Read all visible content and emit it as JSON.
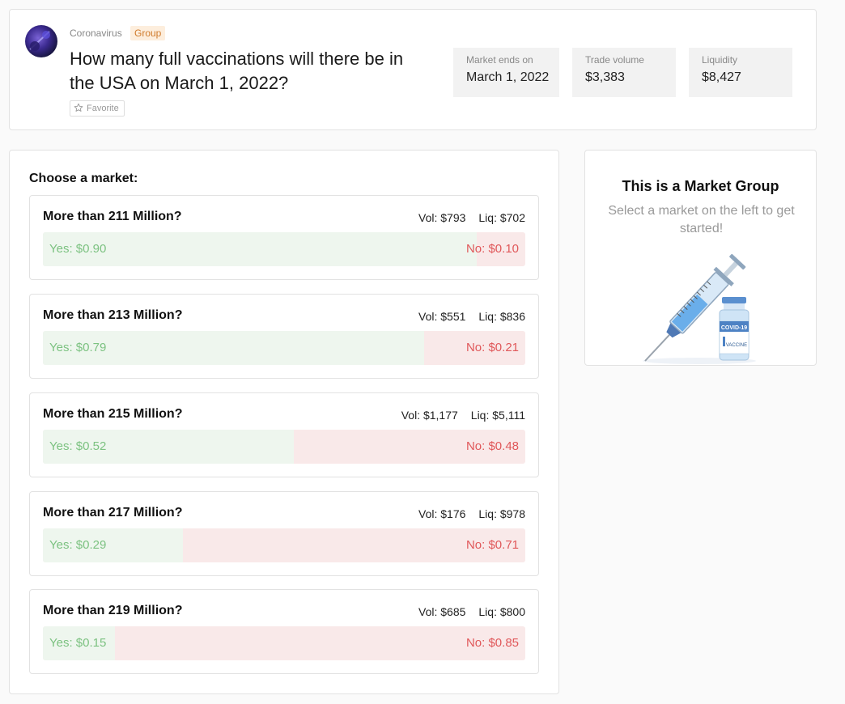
{
  "header": {
    "category": "Coronavirus",
    "badge": "Group",
    "title": "How many full vaccinations will there be in the USA on March 1, 2022?",
    "favorite_label": "Favorite",
    "stats": [
      {
        "label": "Market ends on",
        "value": "March 1, 2022"
      },
      {
        "label": "Trade volume",
        "value": "$3,383"
      },
      {
        "label": "Liquidity",
        "value": "$8,427"
      }
    ]
  },
  "markets": {
    "heading": "Choose a market:",
    "items": [
      {
        "title": "More than 211 Million?",
        "vol": "Vol: $793",
        "liq": "Liq: $702",
        "yes": "Yes: $0.90",
        "no": "No: $0.10",
        "yes_price": 0.9
      },
      {
        "title": "More than 213 Million?",
        "vol": "Vol: $551",
        "liq": "Liq: $836",
        "yes": "Yes: $0.79",
        "no": "No: $0.21",
        "yes_price": 0.79
      },
      {
        "title": "More than 215 Million?",
        "vol": "Vol: $1,177",
        "liq": "Liq: $5,111",
        "yes": "Yes: $0.52",
        "no": "No: $0.48",
        "yes_price": 0.52
      },
      {
        "title": "More than 217 Million?",
        "vol": "Vol: $176",
        "liq": "Liq: $978",
        "yes": "Yes: $0.29",
        "no": "No: $0.71",
        "yes_price": 0.29
      },
      {
        "title": "More than 219 Million?",
        "vol": "Vol: $685",
        "liq": "Liq: $800",
        "yes": "Yes: $0.15",
        "no": "No: $0.85",
        "yes_price": 0.15
      }
    ]
  },
  "sidebar": {
    "title": "This is a Market Group",
    "subtitle": "Select a market on the left to get started!",
    "vial_label_top": "COVID-19",
    "vial_label_bottom": "VACCINE"
  },
  "colors": {
    "yes_text": "#7cc281",
    "no_text": "#e0585a",
    "yes_fill": "#eef6ee",
    "no_fill": "#f9e9e9",
    "badge_bg": "#fdeedd",
    "badge_text": "#d07b2c"
  },
  "icons": {
    "favorite": "star-outline-icon",
    "avatar": "coronavirus-avatar",
    "illustration": "syringe-vaccine-illustration"
  }
}
